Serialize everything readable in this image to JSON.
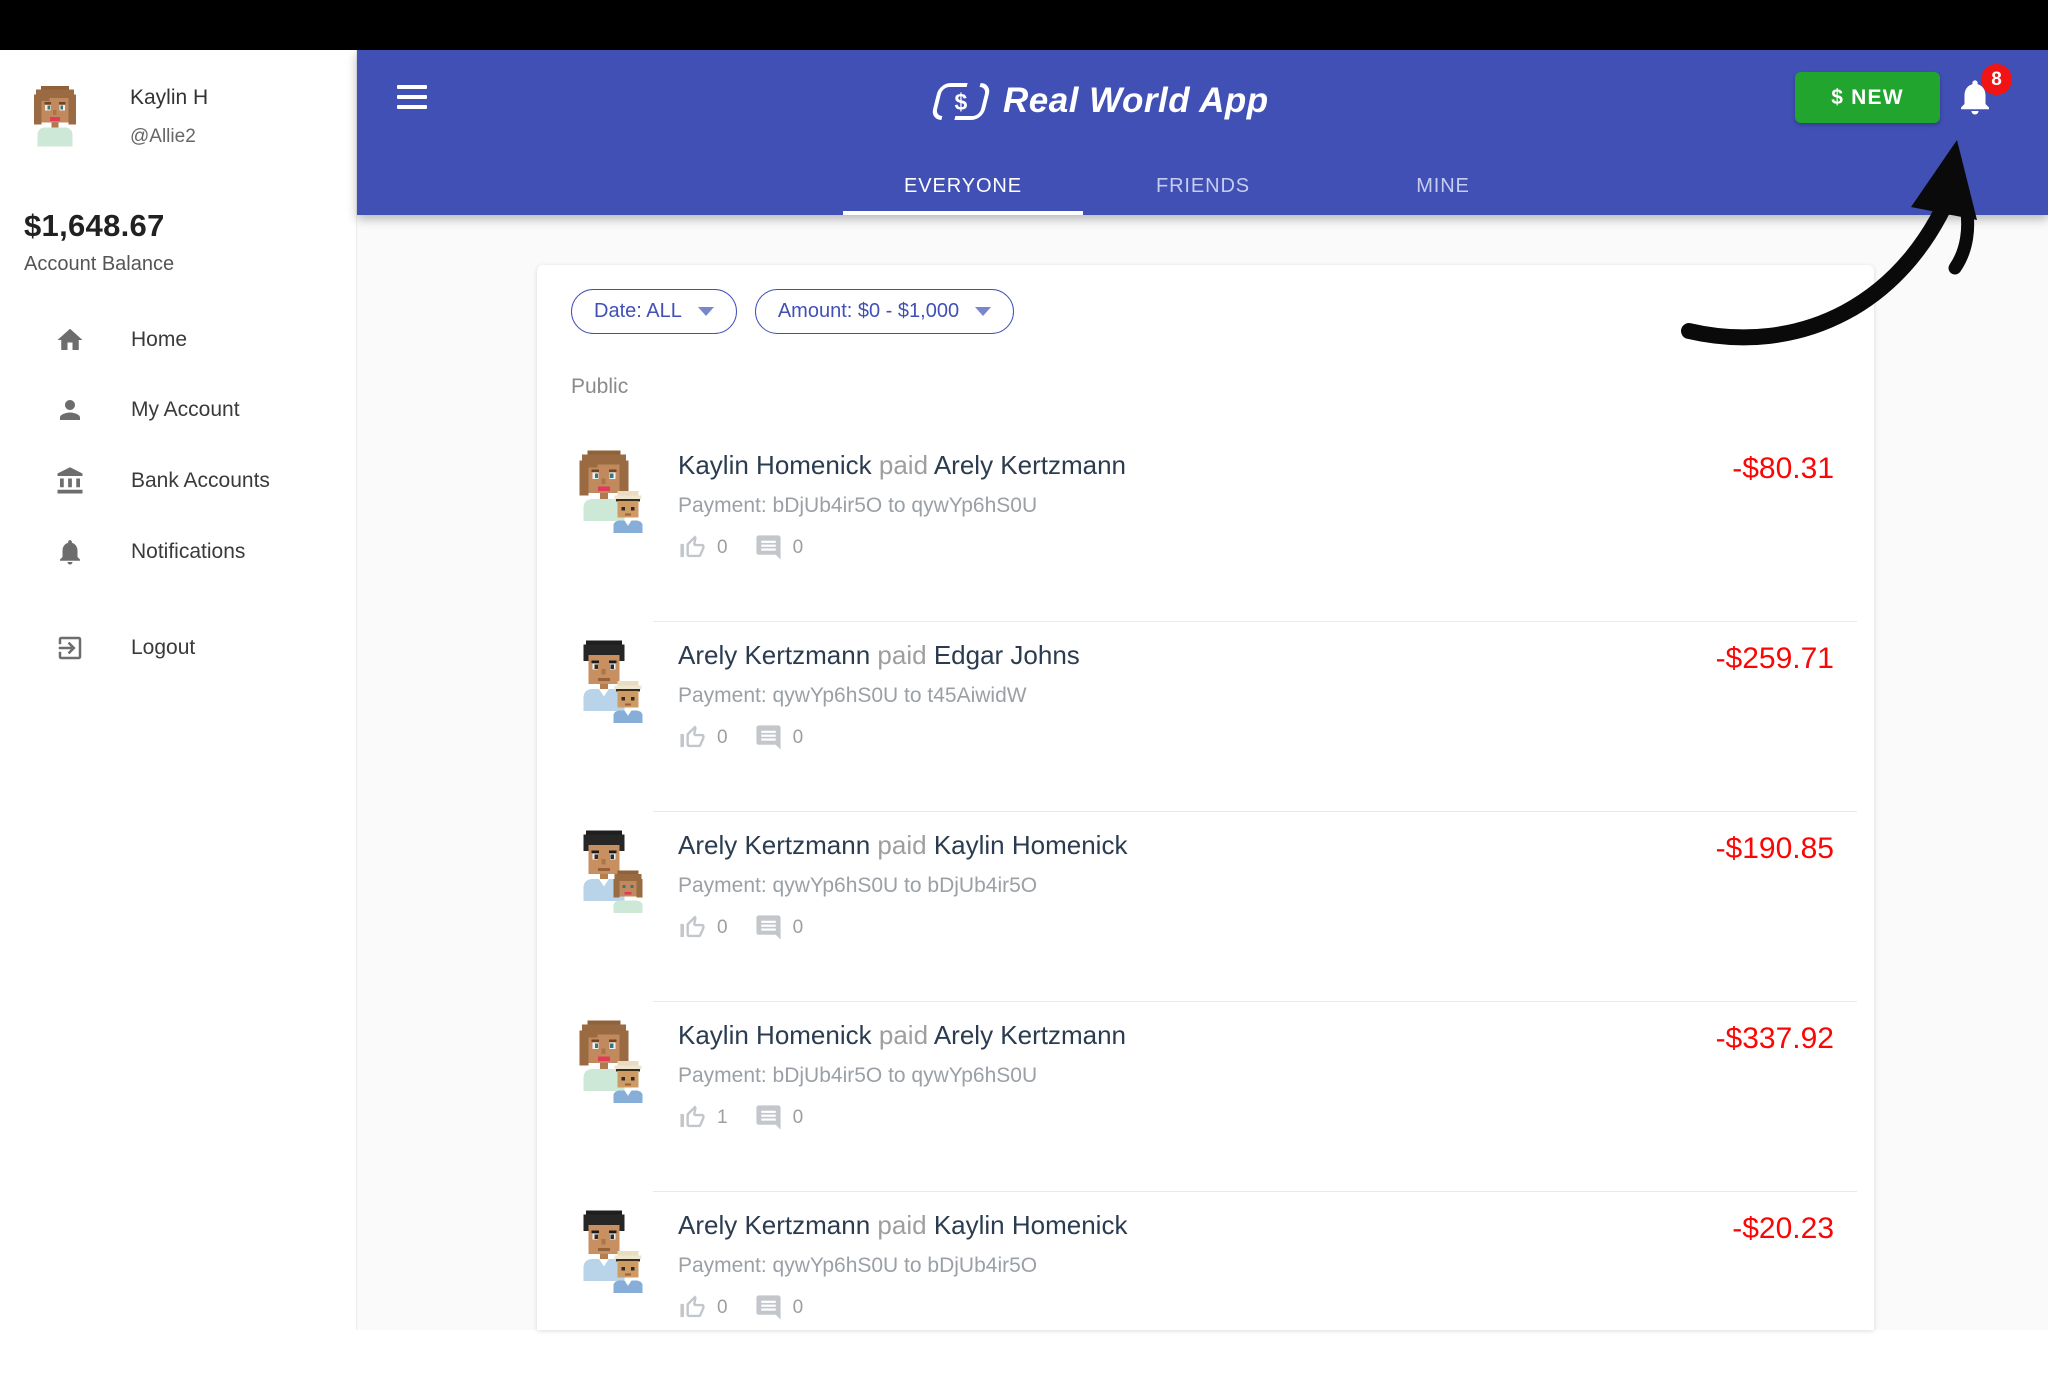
{
  "colors": {
    "appbar_blue": "#4150b5",
    "new_button_green": "#22a52e",
    "badge_red": "#f21414",
    "amount_red": "#fb0505",
    "tab_inactive": "#c7cdf0"
  },
  "header": {
    "menu_icon": "hamburger-icon",
    "logo_icon": "dollar-brackets-icon",
    "logo_dollar": "$",
    "title": "Real World App",
    "new_button_label": "$ NEW",
    "bell_icon": "bell-icon",
    "notification_badge": "8",
    "tabs": [
      {
        "label": "EVERYONE",
        "active": true
      },
      {
        "label": "FRIENDS",
        "active": false
      },
      {
        "label": "MINE",
        "active": false
      }
    ]
  },
  "sidebar": {
    "user": {
      "name": "Kaylin H",
      "username": "@Allie2",
      "avatar": "pixel-woman"
    },
    "balance": {
      "amount": "$1,648.67",
      "label": "Account Balance"
    },
    "nav": [
      {
        "icon": "home-icon",
        "label": "Home"
      },
      {
        "icon": "person-icon",
        "label": "My Account"
      },
      {
        "icon": "bank-icon",
        "label": "Bank Accounts"
      },
      {
        "icon": "bell-icon",
        "label": "Notifications"
      }
    ],
    "logout": {
      "icon": "logout-icon",
      "label": "Logout"
    }
  },
  "filters": {
    "date_label": "Date: ALL",
    "amount_label": "Amount: $0 - $1,000"
  },
  "feed": {
    "section_label": "Public",
    "transactions": [
      {
        "sender": "Kaylin Homenick",
        "action": "paid",
        "receiver": "Arely Kertzmann",
        "description": "Payment: bDjUb4ir5O to qywYp6hS0U",
        "likes": "0",
        "comments": "0",
        "amount": "-$80.31",
        "avatar": "pixel-woman",
        "overlay_avatar": "pixel-boy"
      },
      {
        "sender": "Arely Kertzmann",
        "action": "paid",
        "receiver": "Edgar Johns",
        "description": "Payment: qywYp6hS0U to t45AiwidW",
        "likes": "0",
        "comments": "0",
        "amount": "-$259.71",
        "avatar": "pixel-man",
        "overlay_avatar": "pixel-boy"
      },
      {
        "sender": "Arely Kertzmann",
        "action": "paid",
        "receiver": "Kaylin Homenick",
        "description": "Payment: qywYp6hS0U to bDjUb4ir5O",
        "likes": "0",
        "comments": "0",
        "amount": "-$190.85",
        "avatar": "pixel-man",
        "overlay_avatar": "pixel-girl"
      },
      {
        "sender": "Kaylin Homenick",
        "action": "paid",
        "receiver": "Arely Kertzmann",
        "description": "Payment: bDjUb4ir5O to qywYp6hS0U",
        "likes": "1",
        "comments": "0",
        "amount": "-$337.92",
        "avatar": "pixel-woman",
        "overlay_avatar": "pixel-boy"
      },
      {
        "sender": "Arely Kertzmann",
        "action": "paid",
        "receiver": "Kaylin Homenick",
        "description": "Payment: qywYp6hS0U to bDjUb4ir5O",
        "likes": "0",
        "comments": "0",
        "amount": "-$20.23",
        "avatar": "pixel-man",
        "overlay_avatar": "pixel-boy"
      }
    ]
  }
}
